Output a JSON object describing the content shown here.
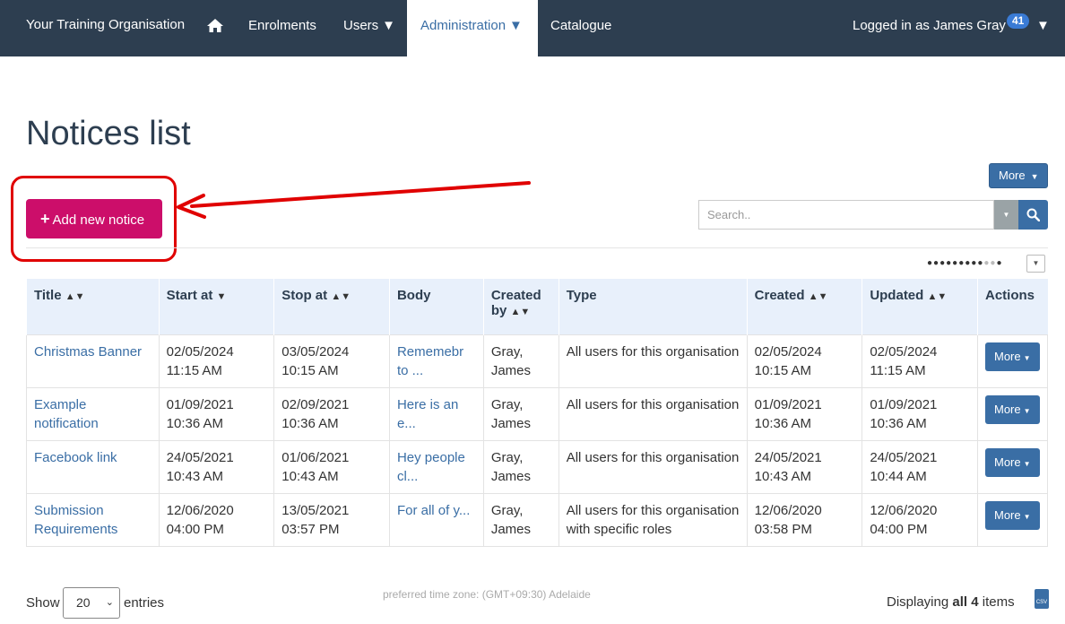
{
  "nav": {
    "brand": "Your Training Organisation",
    "items": [
      {
        "label": "Enrolments"
      },
      {
        "label": "Users"
      },
      {
        "label": "Administration"
      },
      {
        "label": "Catalogue"
      }
    ],
    "login": "Logged in as James Gray",
    "badge": "41"
  },
  "page": {
    "title": "Notices list",
    "add_button": "Add new notice",
    "more_button": "More",
    "search_placeholder": "Search.."
  },
  "table": {
    "headers": [
      "Title",
      "Start at",
      "Stop at",
      "Body",
      "Created by",
      "Type",
      "Created",
      "Updated",
      "Actions"
    ],
    "rows": [
      {
        "title": "Christmas Banner",
        "start": "02/05/2024 11:15 AM",
        "stop": "03/05/2024 10:15 AM",
        "body": "Rememebr to ...",
        "created_by": "Gray, James",
        "type": "All users for this organisation",
        "created": "02/05/2024 10:15 AM",
        "updated": "02/05/2024 11:15 AM",
        "action": "More"
      },
      {
        "title": "Example notification",
        "start": "01/09/2021 10:36 AM",
        "stop": "02/09/2021 10:36 AM",
        "body": "Here is an e...",
        "created_by": "Gray, James",
        "type": "All users for this organisation",
        "created": "01/09/2021 10:36 AM",
        "updated": "01/09/2021 10:36 AM",
        "action": "More"
      },
      {
        "title": "Facebook link",
        "start": "24/05/2021 10:43 AM",
        "stop": "01/06/2021 10:43 AM",
        "body": "Hey people cl...",
        "created_by": "Gray, James",
        "type": "All users for this organisation",
        "created": "24/05/2021 10:43 AM",
        "updated": "24/05/2021 10:44 AM",
        "action": "More"
      },
      {
        "title": "Submission Requirements",
        "start": "12/06/2020 04:00 PM",
        "stop": "13/05/2021 03:57 PM",
        "body": "For all of y...",
        "created_by": "Gray, James",
        "type": "All users for this organisation with specific roles",
        "created": "12/06/2020 03:58 PM",
        "updated": "12/06/2020 04:00 PM",
        "action": "More"
      }
    ]
  },
  "footer": {
    "show": "Show",
    "page_size": "20",
    "entries": "entries",
    "timezone": "preferred time zone: (GMT+09:30) Adelaide",
    "displaying_prefix": "Displaying",
    "displaying_count": "all 4",
    "displaying_suffix": "items",
    "csv_label": "CSV"
  },
  "colors": {
    "nav_bg": "#2d3e50",
    "primary": "#3a6ea5",
    "add_button": "#cc0e6a",
    "highlight": "#e00000"
  }
}
